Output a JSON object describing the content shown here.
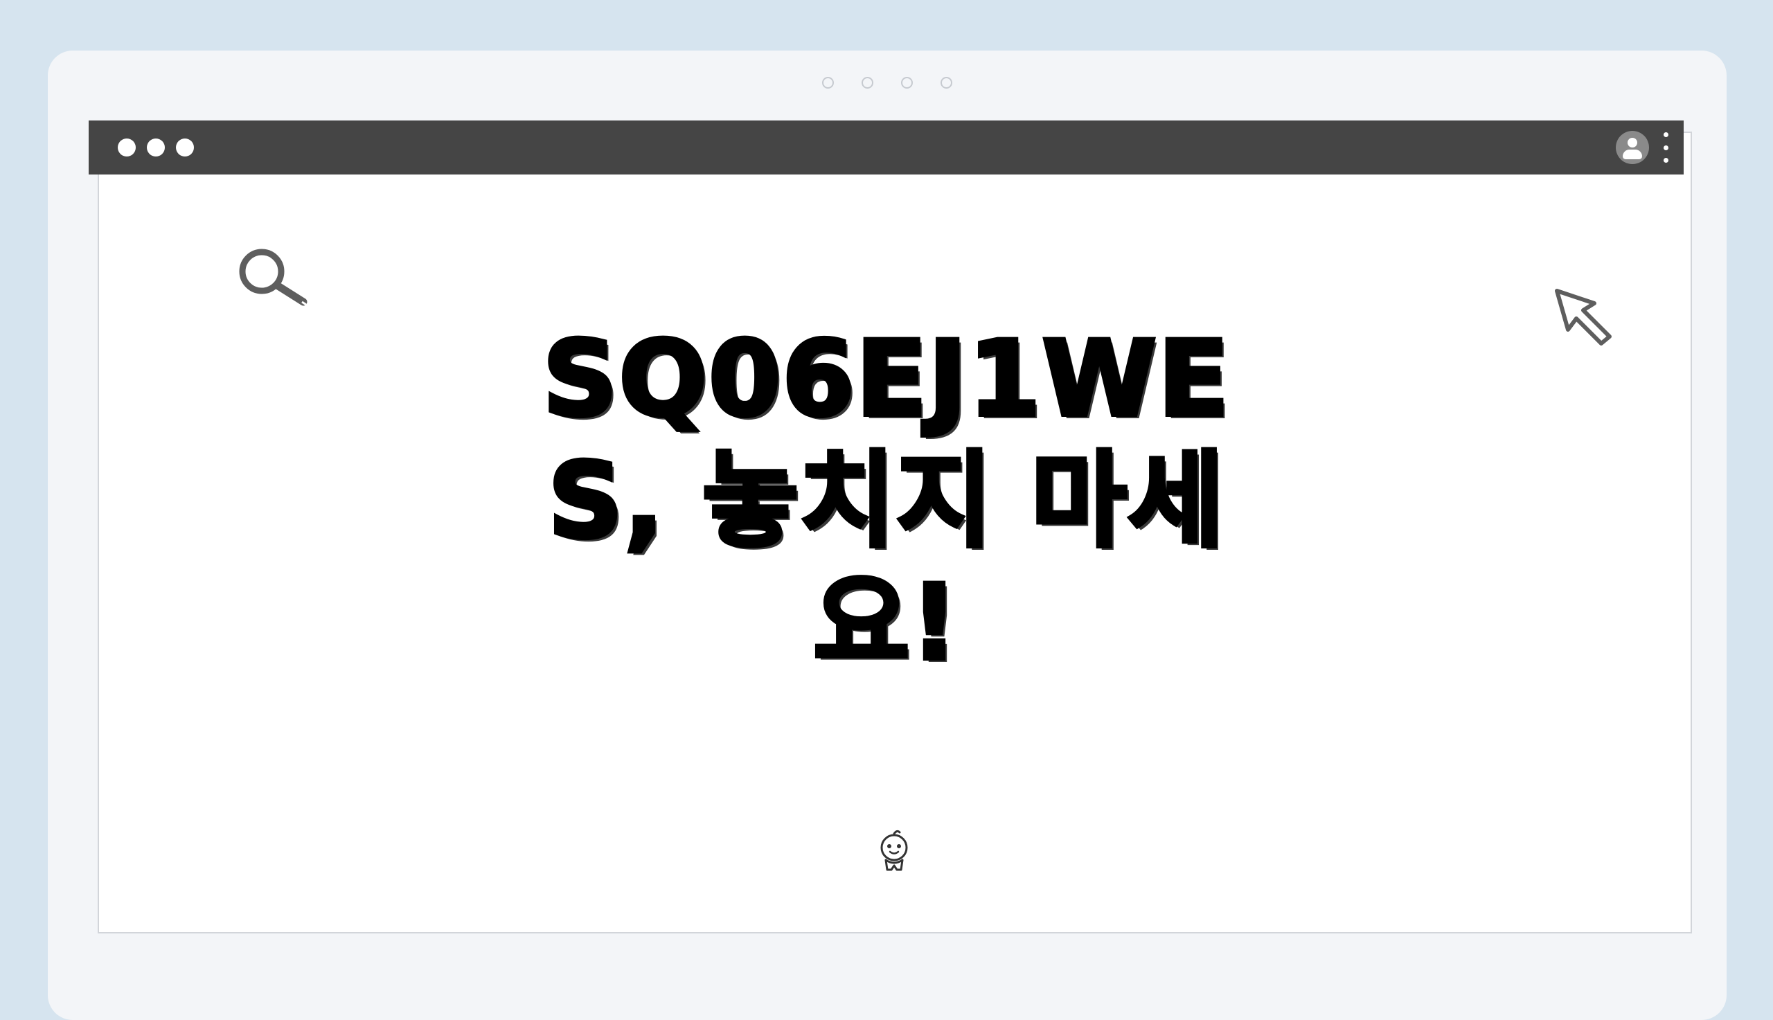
{
  "window": {
    "controls": [
      "close",
      "minimize",
      "maximize"
    ],
    "titlebar_color": "#454545"
  },
  "header_icons": {
    "profile": "avatar-icon",
    "menu": "kebab-menu-icon"
  },
  "main": {
    "headline": "SQ06EJ1WES, 놓치지 마세요!",
    "decorations": [
      "search-icon",
      "cursor-icon",
      "mascot-icon"
    ]
  },
  "colors": {
    "background": "#d6e4ef",
    "device": "#f3f5f8",
    "content": "#ffffff",
    "text": "#000000"
  }
}
